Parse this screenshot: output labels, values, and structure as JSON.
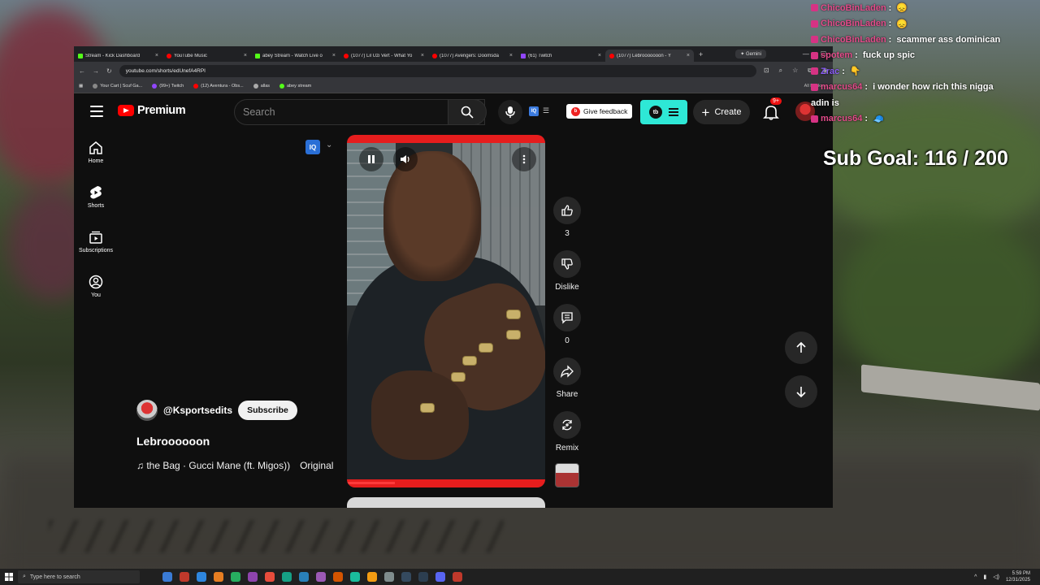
{
  "browser": {
    "tabs": [
      {
        "title": "Stream - Kick Dashboard",
        "color": "#53fc18"
      },
      {
        "title": "YouTube Music",
        "color": "#ff0000"
      },
      {
        "title": "abey Stream - Watch Live o",
        "color": "#53fc18"
      },
      {
        "title": "(1077) Lil Uzi Vert - What Yo",
        "color": "#ff0000"
      },
      {
        "title": "(1077) Avengers: Doomsda",
        "color": "#ff0000"
      },
      {
        "title": "(61) Twitch",
        "color": "#9146ff"
      },
      {
        "title": "(1077) Lebrooooooon - Y",
        "color": "#ff0000"
      }
    ],
    "gemini_label": "Gemini",
    "url": "youtube.com/shorts/edUnefA4RPI",
    "bookmarks": [
      {
        "label": "Your Cart | Scuf Ga...",
        "color": "#888"
      },
      {
        "label": "(99+) Twitch",
        "color": "#9146ff"
      },
      {
        "label": "(12) Aventura - Obs...",
        "color": "#ff0000"
      },
      {
        "label": "allas",
        "color": "#aaa"
      },
      {
        "label": "abey stream",
        "color": "#53fc18"
      }
    ],
    "all_bookmarks": "All Bookm..."
  },
  "youtube": {
    "logo_text": "Premium",
    "search_placeholder": "Search",
    "give_feedback": "Give feedback",
    "create_label": "Create",
    "notif_badge": "9+",
    "iq_label": "IQ",
    "ext_label": "tb",
    "sidebar": [
      {
        "label": "Home",
        "icon": "home-icon"
      },
      {
        "label": "Shorts",
        "icon": "shorts-icon"
      },
      {
        "label": "Subscriptions",
        "icon": "subscriptions-icon"
      },
      {
        "label": "You",
        "icon": "account-icon"
      }
    ],
    "short": {
      "channel": "@Ksportsedits",
      "subscribe": "Subscribe",
      "title": "Lebroooooon",
      "sound": "♫ the Bag · Gucci Mane (ft. Migos))",
      "sound_tag": "Original",
      "progress": 0.24
    },
    "actions": {
      "likes": "3",
      "dislike": "Dislike",
      "comments": "0",
      "share": "Share",
      "remix": "Remix"
    }
  },
  "overlay": {
    "chat": [
      {
        "user": "ChicoBinLaden",
        "message": ""
      },
      {
        "user": "ChicoBinLaden",
        "message": ""
      },
      {
        "user": "ChicoBinLaden",
        "message": "scammer ass dominican"
      },
      {
        "user": "spotem",
        "message": "fuck up spic"
      },
      {
        "user": "Zrac",
        "message": ""
      },
      {
        "user": "marcus64",
        "message": "i wonder how rich this nigga"
      },
      {
        "user": "",
        "message": "adin is"
      },
      {
        "user": "marcus64",
        "message": ""
      }
    ],
    "sub_goal": "Sub Goal:  116 / 200"
  },
  "taskbar": {
    "search_placeholder": "Type here to search",
    "time": "5:59 PM",
    "date": "12/31/2025",
    "icon_colors": [
      "#3a7bd5",
      "#c0392b",
      "#2e86de",
      "#e67e22",
      "#27ae60",
      "#8e44ad",
      "#e74c3c",
      "#16a085",
      "#2980b9",
      "#9b59b6",
      "#d35400",
      "#1abc9c",
      "#f39c12",
      "#7f8c8d",
      "#34495e",
      "#2c3e50",
      "#5865f2",
      "#c0392b"
    ]
  }
}
